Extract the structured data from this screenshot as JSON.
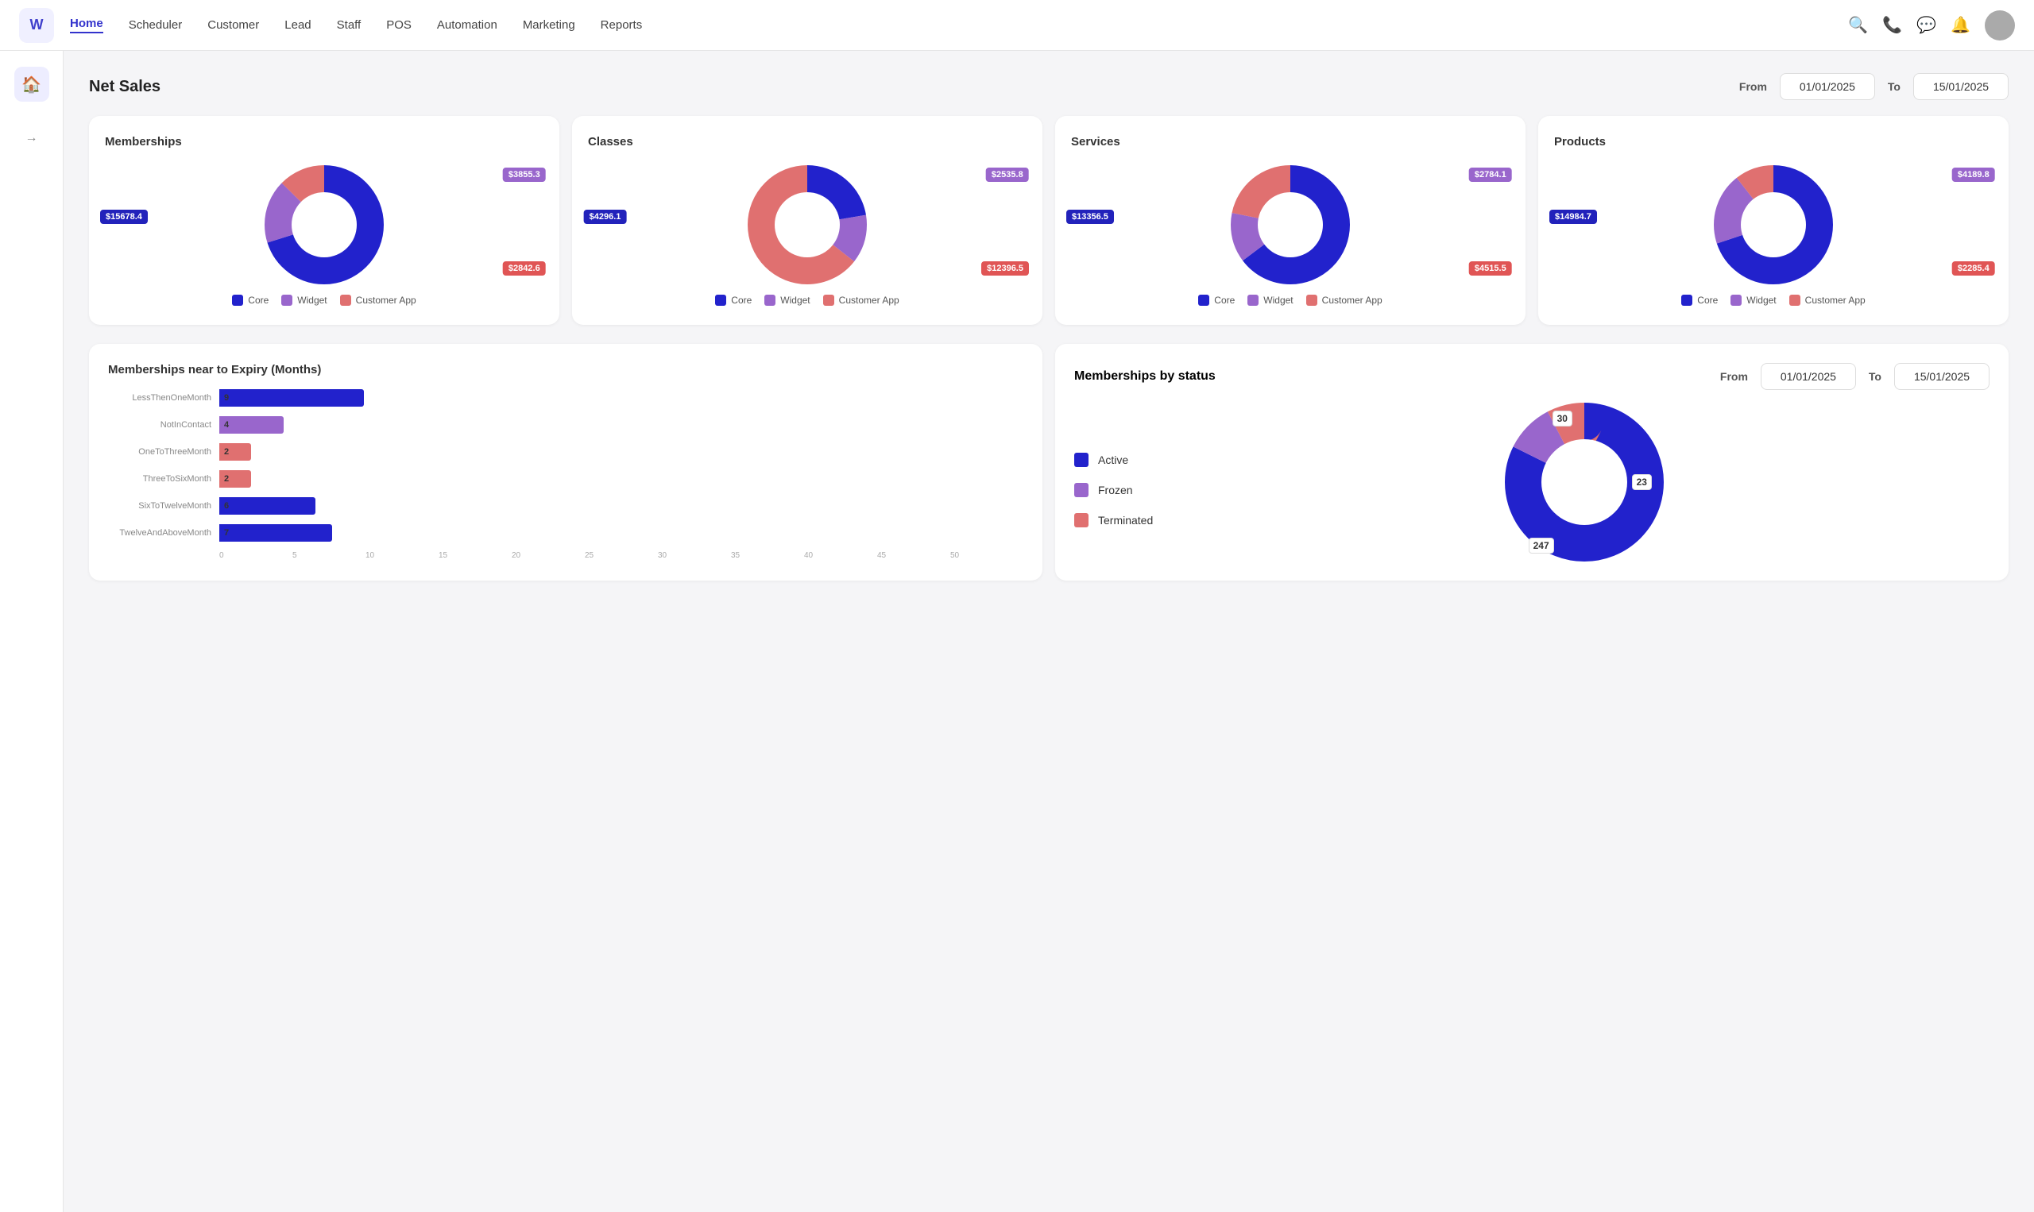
{
  "brand": "W",
  "nav": {
    "links": [
      "Home",
      "Scheduler",
      "Customer",
      "Lead",
      "Staff",
      "POS",
      "Automation",
      "Marketing",
      "Reports"
    ],
    "active": "Home"
  },
  "header": {
    "title": "Net Sales",
    "from_label": "From",
    "from_date": "01/01/2025",
    "to_label": "To",
    "to_date": "15/01/2025"
  },
  "charts": [
    {
      "id": "memberships",
      "title": "Memberships",
      "values": {
        "core": 15678.4,
        "widget": 3855.3,
        "customerApp": 2842.6
      },
      "labels": {
        "core": "$15678.4",
        "widget": "$3855.3",
        "customerApp": "$2842.6"
      }
    },
    {
      "id": "classes",
      "title": "Classes",
      "values": {
        "core": 4296.1,
        "widget": 2535.8,
        "customerApp": 12396.5
      },
      "labels": {
        "core": "$4296.1",
        "widget": "$2535.8",
        "customerApp": "$12396.5"
      }
    },
    {
      "id": "services",
      "title": "Services",
      "values": {
        "core": 13356.5,
        "widget": 2784.1,
        "customerApp": 4515.5
      },
      "labels": {
        "core": "$13356.5",
        "widget": "$2784.1",
        "customerApp": "$4515.5"
      }
    },
    {
      "id": "products",
      "title": "Products",
      "values": {
        "core": 14984.7,
        "widget": 4189.8,
        "customerApp": 2285.4
      },
      "labels": {
        "core": "$14984.7",
        "widget": "$4189.8",
        "customerApp": "$2285.4"
      }
    }
  ],
  "legend": [
    "Core",
    "Widget",
    "Customer App"
  ],
  "expiry": {
    "title": "Memberships near to Expiry (Months)",
    "bars": [
      {
        "label": "LessThenOneMonth",
        "value": 9,
        "color": "#2222cc",
        "maxWidth": 90
      },
      {
        "label": "NotInContact",
        "value": 4,
        "color": "#9966cc",
        "maxWidth": 40
      },
      {
        "label": "OneToThreeMonth",
        "value": 2,
        "color": "#e07070",
        "maxWidth": 30
      },
      {
        "label": "ThreeToSixMonth",
        "value": 2,
        "color": "#e07070",
        "maxWidth": 28
      },
      {
        "label": "SixToTwelveMonth",
        "value": 6,
        "color": "#2222cc",
        "maxWidth": 68
      },
      {
        "label": "TwelveAndAboveMonth",
        "value": 7,
        "color": "#2222cc",
        "maxWidth": 78
      }
    ],
    "xTicks": [
      "0",
      "5",
      "10",
      "15",
      "20",
      "25",
      "30",
      "35",
      "40",
      "45",
      "50"
    ]
  },
  "membershipStatus": {
    "title": "Memberships by status",
    "from_label": "From",
    "from_date": "01/01/2025",
    "to_label": "To",
    "to_date": "15/01/2025",
    "legend": [
      {
        "label": "Active",
        "color": "#2222cc"
      },
      {
        "label": "Frozen",
        "color": "#9966cc"
      },
      {
        "label": "Terminated",
        "color": "#e07070"
      }
    ],
    "values": {
      "active": 247,
      "frozen": 30,
      "terminated": 23
    }
  }
}
